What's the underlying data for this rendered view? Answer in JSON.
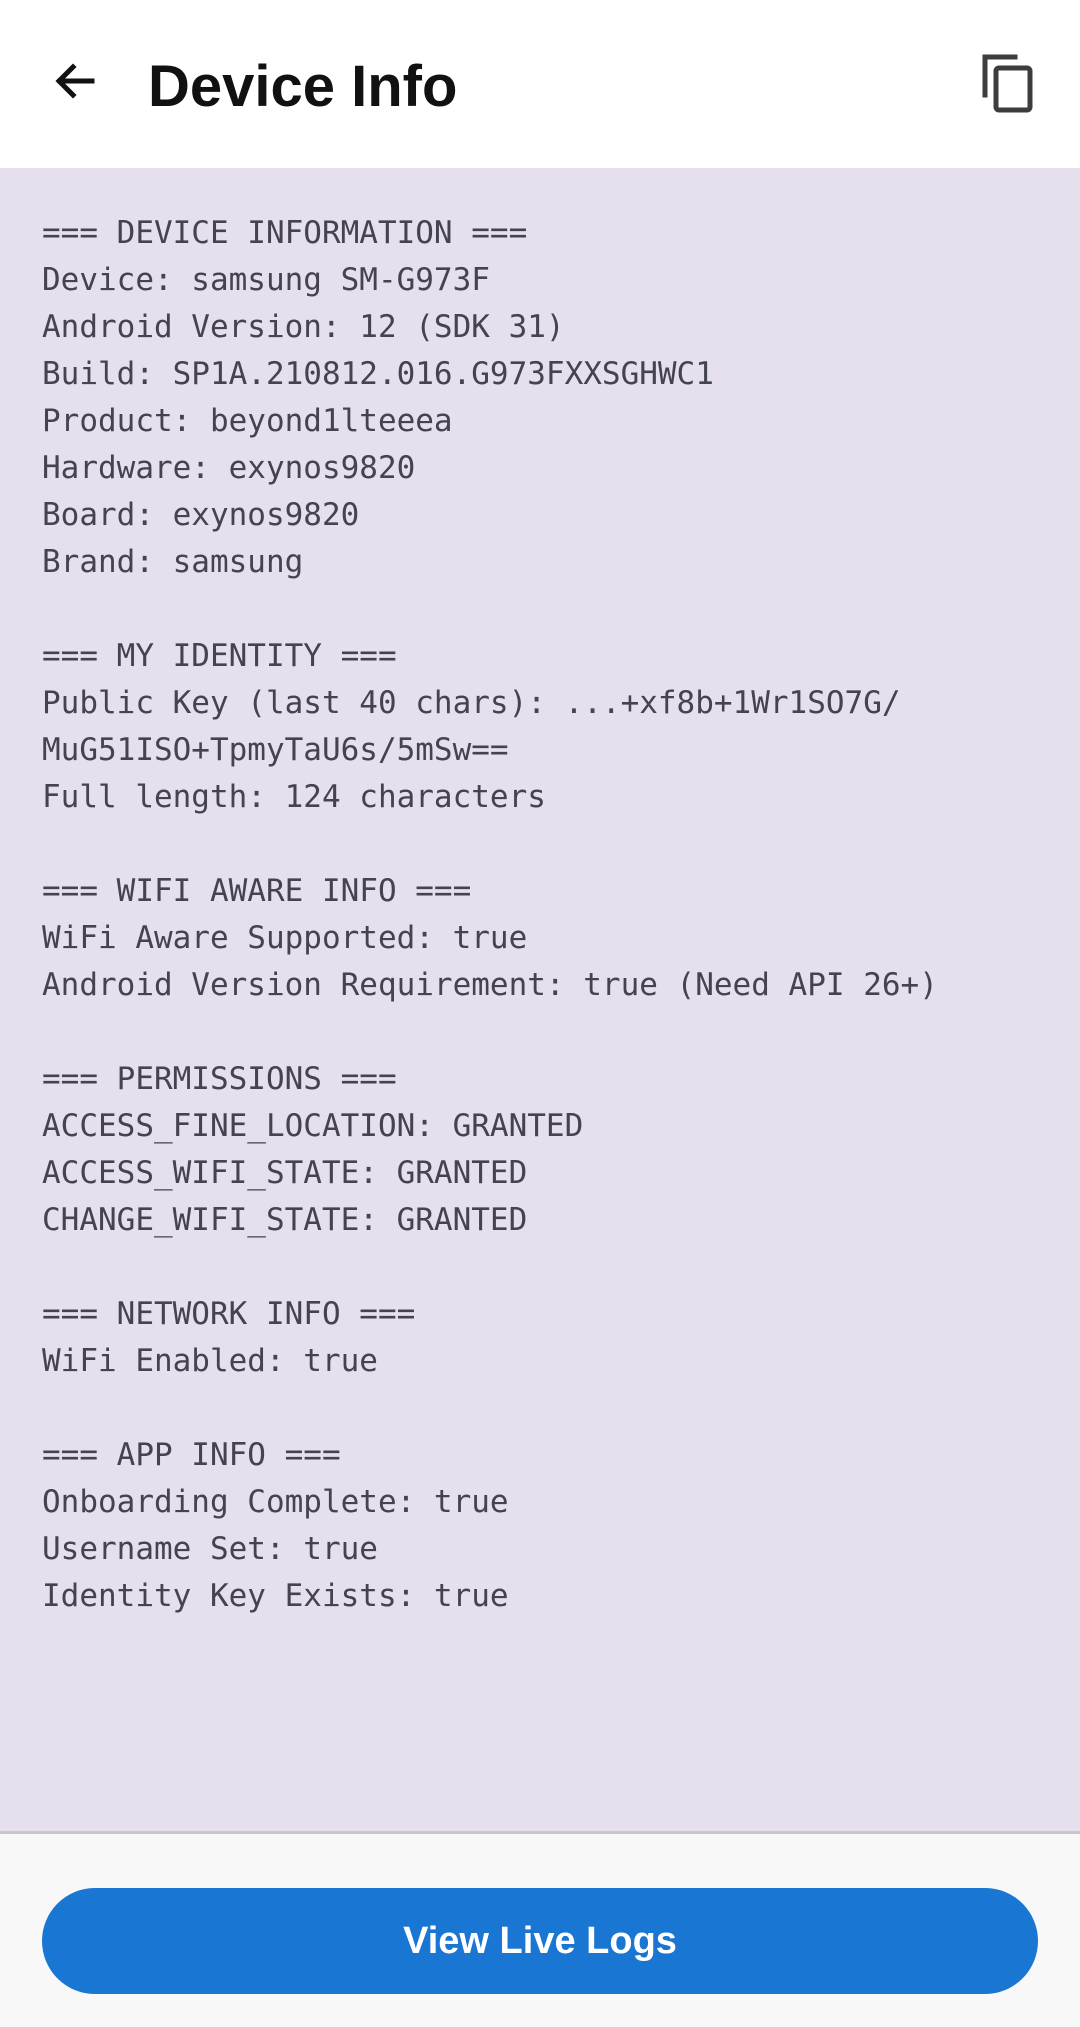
{
  "app_bar": {
    "title": "Device Info",
    "back_icon": "arrow-back-icon",
    "copy_icon": "copy-icon"
  },
  "info": {
    "lines": [
      "=== DEVICE INFORMATION ===",
      "Device: samsung SM-G973F",
      "Android Version: 12 (SDK 31)",
      "Build: SP1A.210812.016.G973FXXSGHWC1",
      "Product: beyond1lteeea",
      "Hardware: exynos9820",
      "Board: exynos9820",
      "Brand: samsung",
      "",
      "=== MY IDENTITY ===",
      "Public Key (last 40 chars): ...+xf8b+1Wr1SO7G/",
      "MuG51ISO+TpmyTaU6s/5mSw==",
      "Full length: 124 characters",
      "",
      "=== WIFI AWARE INFO ===",
      "WiFi Aware Supported: true",
      "Android Version Requirement: true (Need API 26+)",
      "",
      "=== PERMISSIONS ===",
      "ACCESS_FINE_LOCATION: GRANTED",
      "ACCESS_WIFI_STATE: GRANTED",
      "CHANGE_WIFI_STATE: GRANTED",
      "",
      "=== NETWORK INFO ===",
      "WiFi Enabled: true",
      "",
      "=== APP INFO ===",
      "Onboarding Complete: true",
      "Username Set: true",
      "Identity Key Exists: true"
    ]
  },
  "bottom": {
    "button_label": "View Live Logs"
  },
  "colors": {
    "panel_background": "#e6dfec",
    "button_primary": "#1976d2",
    "text": "#45434d"
  }
}
